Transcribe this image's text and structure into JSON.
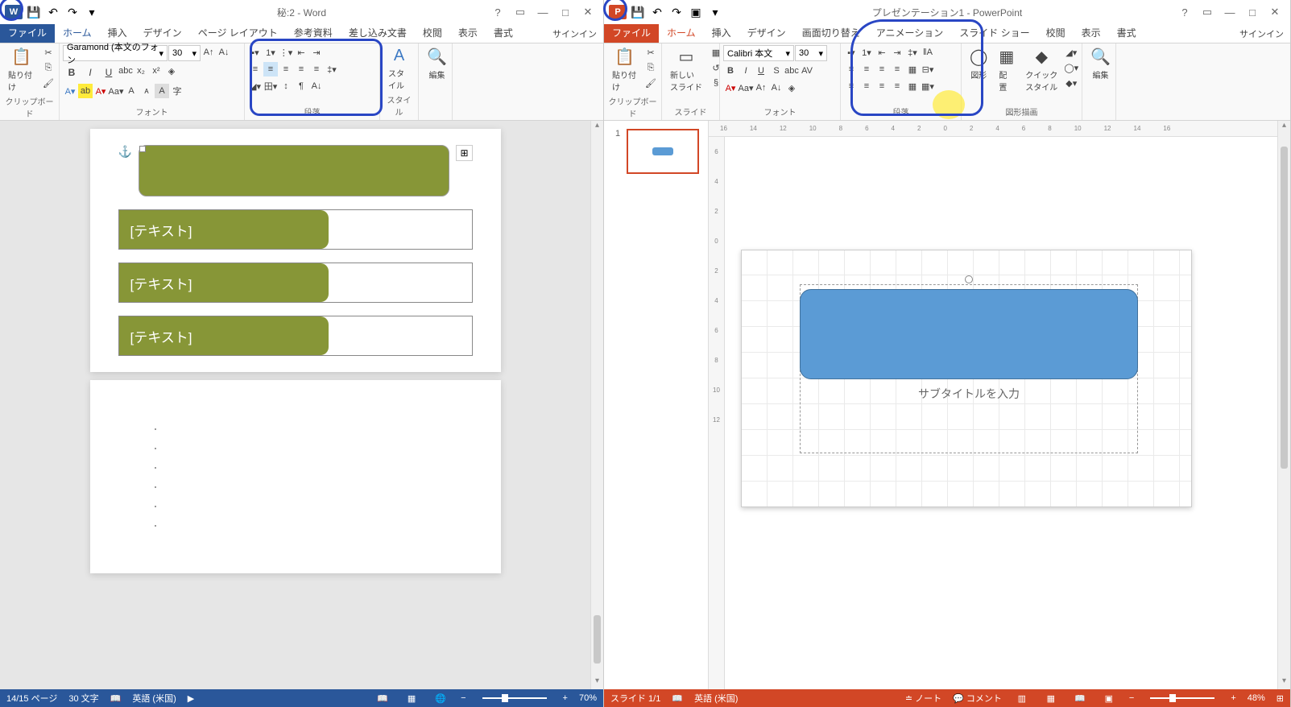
{
  "word": {
    "title": "秘:2 - Word",
    "qat": {
      "save": "💾",
      "undo": "↶",
      "redo": "↷",
      "touch": "👆"
    },
    "tabs": {
      "file": "ファイル",
      "home": "ホーム",
      "insert": "挿入",
      "design": "デザイン",
      "layout": "ページ レイアウト",
      "ref": "参考資料",
      "mail": "差し込み文書",
      "review": "校閲",
      "view": "表示",
      "format": "書式"
    },
    "signin": "サインイン",
    "ribbon": {
      "clipboard": "クリップボード",
      "paste": "貼り付け",
      "font": "フォント",
      "font_name": "Garamond (本文のフォン",
      "font_size": "30",
      "para": "段落",
      "styles": "スタイル",
      "editing": "編集"
    },
    "doc": {
      "text1": "[テキスト]",
      "text2": "[テキスト]",
      "text3": "[テキスト]"
    },
    "status": {
      "page": "14/15 ページ",
      "words": "30 文字",
      "lang": "英語 (米国)",
      "zoom": "70%"
    }
  },
  "ppt": {
    "title": "プレゼンテーション1 - PowerPoint",
    "tabs": {
      "file": "ファイル",
      "home": "ホーム",
      "insert": "挿入",
      "design": "デザイン",
      "trans": "画面切り替え",
      "anim": "アニメーション",
      "show": "スライド ショー",
      "review": "校閲",
      "view": "表示",
      "format": "書式"
    },
    "signin": "サインイン",
    "ribbon": {
      "clipboard": "クリップボード",
      "paste": "貼り付け",
      "slides": "スライド",
      "newslide": "新しい\nスライド",
      "font": "フォント",
      "font_name": "Calibri 本文",
      "font_size": "30",
      "para": "段落",
      "drawing": "図形描画",
      "shapes": "図形",
      "arrange": "配置",
      "quick": "クイック\nスタイル",
      "editing": "編集"
    },
    "slide": {
      "subtitle": "サブタイトルを入力",
      "num": "1"
    },
    "ruler": [
      "16",
      "14",
      "12",
      "10",
      "8",
      "6",
      "4",
      "2",
      "0",
      "2",
      "4",
      "6",
      "8",
      "10",
      "12",
      "14",
      "16"
    ],
    "vruler": [
      "6",
      "4",
      "2",
      "0",
      "2",
      "4",
      "6",
      "8",
      "10",
      "12"
    ],
    "status": {
      "slide": "スライド 1/1",
      "lang": "英語 (米国)",
      "notes": "ノート",
      "comments": "コメント",
      "zoom": "48%"
    }
  }
}
